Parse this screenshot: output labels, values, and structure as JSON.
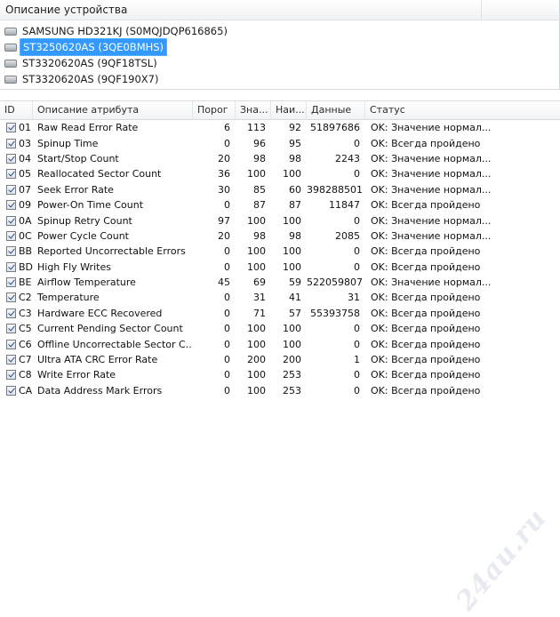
{
  "devices_pane": {
    "header": "Описание устройства",
    "devices": [
      {
        "name": "SAMSUNG HD321KJ (S0MQJDQP616865)",
        "selected": false
      },
      {
        "name": "ST3250620AS (3QE0BMHS)",
        "selected": true
      },
      {
        "name": "ST3320620AS (9QF18TSL)",
        "selected": false
      },
      {
        "name": "ST3320620AS (9QF190X7)",
        "selected": false
      }
    ]
  },
  "attributes_pane": {
    "columns": {
      "id": "ID",
      "description": "Описание атрибута",
      "threshold": "Порог",
      "value": "Зна...",
      "worst": "Наи...",
      "raw": "Данные",
      "status": "Статус"
    },
    "rows": [
      {
        "id": "01",
        "desc": "Raw Read Error Rate",
        "thr": "6",
        "val": "113",
        "worst": "92",
        "raw": "51897686",
        "status": "OK: Значение нормал..."
      },
      {
        "id": "03",
        "desc": "Spinup Time",
        "thr": "0",
        "val": "96",
        "worst": "95",
        "raw": "0",
        "status": "OK: Всегда пройдено"
      },
      {
        "id": "04",
        "desc": "Start/Stop Count",
        "thr": "20",
        "val": "98",
        "worst": "98",
        "raw": "2243",
        "status": "OK: Значение нормал..."
      },
      {
        "id": "05",
        "desc": "Reallocated Sector Count",
        "thr": "36",
        "val": "100",
        "worst": "100",
        "raw": "0",
        "status": "OK: Значение нормал..."
      },
      {
        "id": "07",
        "desc": "Seek Error Rate",
        "thr": "30",
        "val": "85",
        "worst": "60",
        "raw": "398288501",
        "status": "OK: Значение нормал..."
      },
      {
        "id": "09",
        "desc": "Power-On Time Count",
        "thr": "0",
        "val": "87",
        "worst": "87",
        "raw": "11847",
        "status": "OK: Всегда пройдено"
      },
      {
        "id": "0A",
        "desc": "Spinup Retry Count",
        "thr": "97",
        "val": "100",
        "worst": "100",
        "raw": "0",
        "status": "OK: Значение нормал..."
      },
      {
        "id": "0C",
        "desc": "Power Cycle Count",
        "thr": "20",
        "val": "98",
        "worst": "98",
        "raw": "2085",
        "status": "OK: Значение нормал..."
      },
      {
        "id": "BB",
        "desc": "Reported Uncorrectable Errors",
        "thr": "0",
        "val": "100",
        "worst": "100",
        "raw": "0",
        "status": "OK: Всегда пройдено"
      },
      {
        "id": "BD",
        "desc": "High Fly Writes",
        "thr": "0",
        "val": "100",
        "worst": "100",
        "raw": "0",
        "status": "OK: Всегда пройдено"
      },
      {
        "id": "BE",
        "desc": "Airflow Temperature",
        "thr": "45",
        "val": "69",
        "worst": "59",
        "raw": "522059807",
        "status": "OK: Значение нормал..."
      },
      {
        "id": "C2",
        "desc": "Temperature",
        "thr": "0",
        "val": "31",
        "worst": "41",
        "raw": "31",
        "status": "OK: Всегда пройдено"
      },
      {
        "id": "C3",
        "desc": "Hardware ECC Recovered",
        "thr": "0",
        "val": "71",
        "worst": "57",
        "raw": "55393758",
        "status": "OK: Всегда пройдено"
      },
      {
        "id": "C5",
        "desc": "Current Pending Sector Count",
        "thr": "0",
        "val": "100",
        "worst": "100",
        "raw": "0",
        "status": "OK: Всегда пройдено"
      },
      {
        "id": "C6",
        "desc": "Offline Uncorrectable Sector C...",
        "thr": "0",
        "val": "100",
        "worst": "100",
        "raw": "0",
        "status": "OK: Всегда пройдено"
      },
      {
        "id": "C7",
        "desc": "Ultra ATA CRC Error Rate",
        "thr": "0",
        "val": "200",
        "worst": "200",
        "raw": "1",
        "status": "OK: Всегда пройдено"
      },
      {
        "id": "C8",
        "desc": "Write Error Rate",
        "thr": "0",
        "val": "100",
        "worst": "253",
        "raw": "0",
        "status": "OK: Всегда пройдено"
      },
      {
        "id": "CA",
        "desc": "Data Address Mark Errors",
        "thr": "0",
        "val": "100",
        "worst": "253",
        "raw": "0",
        "status": "OK: Всегда пройдено"
      }
    ]
  },
  "watermark": "24au.ru"
}
